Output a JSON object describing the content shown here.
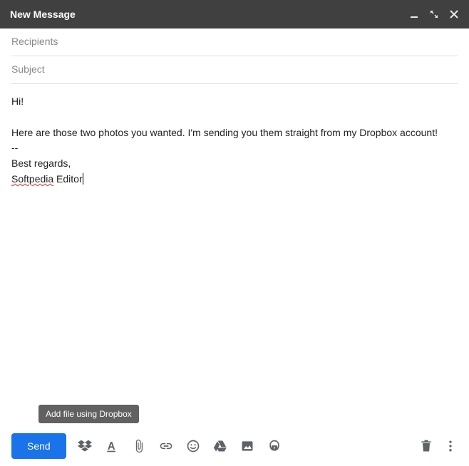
{
  "window": {
    "title": "New Message"
  },
  "fields": {
    "recipients_placeholder": "Recipients",
    "recipients_value": "",
    "subject_placeholder": "Subject",
    "subject_value": ""
  },
  "body": {
    "greeting": "Hi!",
    "paragraph": "Here are those two photos you wanted. I'm sending you them straight from my Dropbox account!",
    "sig_separator": "--",
    "sig_line1": "Best regards,",
    "sig_line2_misspelled": "Softpedia",
    "sig_line2_rest": " Editor"
  },
  "tooltip": {
    "dropbox": "Add file using Dropbox"
  },
  "toolbar": {
    "send_label": "Send"
  }
}
